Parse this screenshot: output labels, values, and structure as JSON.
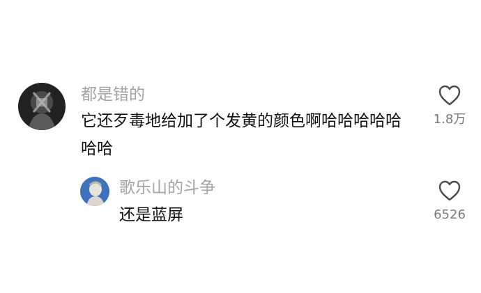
{
  "comments": [
    {
      "username": "都是错的",
      "text": "它还歹毒地给加了个发黄的颜色啊哈哈哈哈哈哈哈",
      "likes": "1.8万"
    }
  ],
  "reply": {
    "username": "歌乐山的斗争",
    "text": "还是蓝屏",
    "likes": "6526"
  },
  "icons": {
    "like": "heart-outline-icon"
  }
}
